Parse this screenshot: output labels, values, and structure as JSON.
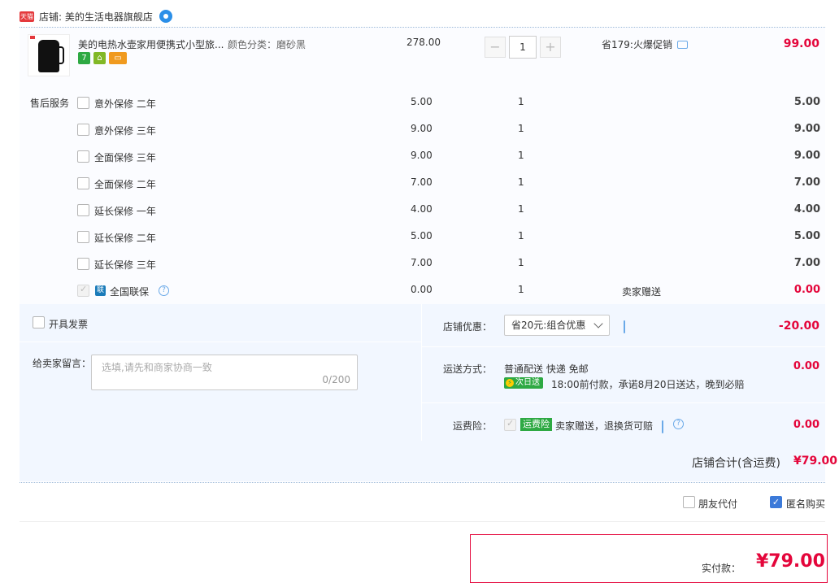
{
  "shop": {
    "badge": "天猫",
    "label": "店铺: 美的生活电器旗舰店"
  },
  "product": {
    "title": "美的电热水壶家用便携式小型旅...",
    "sku": "颜色分类：磨砂黑",
    "price": "278.00",
    "quantity": "1",
    "minus": "−",
    "plus": "+",
    "promo": "省179:火爆促销",
    "total": "99.00",
    "service_icon_text": "7"
  },
  "after_sales": {
    "label": "售后服务",
    "items": [
      {
        "name": "意外保修 二年",
        "price": "5.00",
        "qty": "1",
        "amount": "5.00"
      },
      {
        "name": "意外保修 三年",
        "price": "9.00",
        "qty": "1",
        "amount": "9.00"
      },
      {
        "name": "全面保修 三年",
        "price": "9.00",
        "qty": "1",
        "amount": "9.00"
      },
      {
        "name": "全面保修 二年",
        "price": "7.00",
        "qty": "1",
        "amount": "7.00"
      },
      {
        "name": "延长保修 一年",
        "price": "4.00",
        "qty": "1",
        "amount": "4.00"
      },
      {
        "name": "延长保修 二年",
        "price": "5.00",
        "qty": "1",
        "amount": "5.00"
      },
      {
        "name": "延长保修 三年",
        "price": "7.00",
        "qty": "1",
        "amount": "7.00"
      }
    ],
    "lianbao": {
      "icon": "联",
      "name": "全国联保",
      "price": "0.00",
      "qty": "1",
      "note": "卖家赠送",
      "amount": "0.00"
    }
  },
  "invoice": {
    "label": "开具发票"
  },
  "message": {
    "label": "给卖家留言：",
    "placeholder": "选填,请先和商家协商一致",
    "count": "0/200"
  },
  "discount": {
    "label": "店铺优惠：",
    "selected": "省20元:组合优惠",
    "amount": "-20.00"
  },
  "shipping": {
    "label": "运送方式：",
    "method": "普通配送 快递 免邮",
    "badge": "次日送",
    "promise": "18:00前付款，承诺8月20日送达，晚到必赔",
    "amount": "0.00"
  },
  "insurance": {
    "label": "运费险：",
    "badge": "运费险",
    "text": "卖家赠送，退换货可赔",
    "amount": "0.00"
  },
  "shop_total": {
    "label": "店铺合计(含运费)",
    "amount": "¥79.00"
  },
  "options": {
    "friend_pay": "朋友代付",
    "anonymous": "匿名购买"
  },
  "payment": {
    "label": "实付款：",
    "amount": "¥79.00"
  }
}
